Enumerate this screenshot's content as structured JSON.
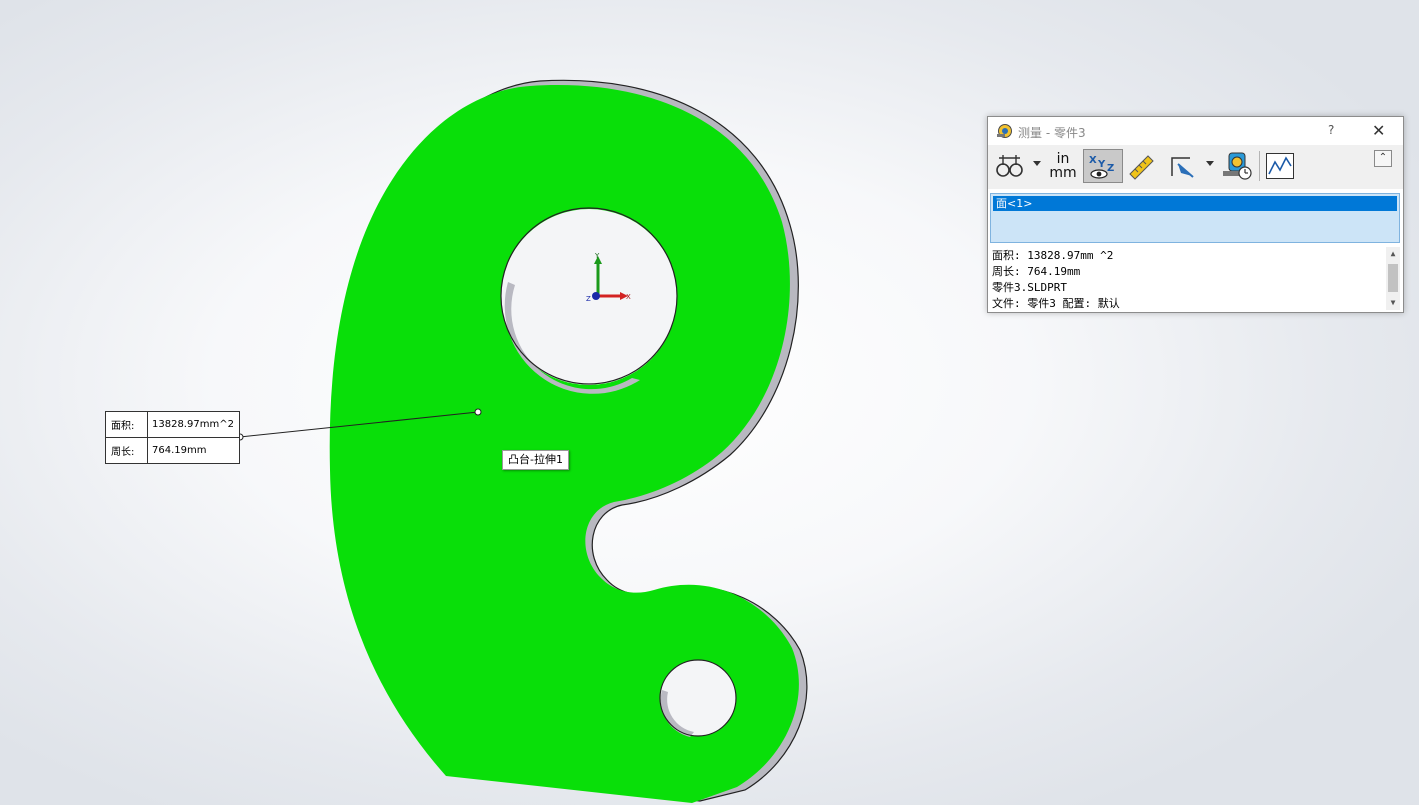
{
  "viewport": {
    "part_color": "#09df09",
    "edge_color": "#222222",
    "side_color": "#b8b8c0",
    "triad": {
      "y_label": "Y",
      "x_label": "X",
      "z_label": "Z"
    },
    "callout": {
      "area_label": "面积:",
      "area_value": "13828.97mm^2",
      "perimeter_label": "周长:",
      "perimeter_value": "764.19mm"
    },
    "feature_tooltip": "凸台-拉伸1"
  },
  "measure_window": {
    "title": "测量 - 零件3",
    "help": "?",
    "close": "✕",
    "toolbar": {
      "arc_circle_icon": "arc-circle-measure-icon",
      "units_in": "in",
      "units_mm": "mm",
      "xyz_icon": "xyz-show-icon",
      "point_to_point_icon": "point-to-point-icon",
      "projection_icon": "projection-icon",
      "history_icon": "measure-history-icon",
      "sensor_icon": "sensor-icon",
      "collapse": "⌃"
    },
    "selection": [
      "面<1>"
    ],
    "results": [
      "面积: 13828.97mm ^2",
      "周长: 764.19mm",
      "零件3.SLDPRT",
      "文件: 零件3 配置: 默认"
    ],
    "accent": "#0078d7"
  }
}
